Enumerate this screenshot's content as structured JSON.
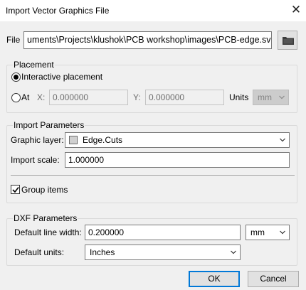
{
  "window": {
    "title": "Import Vector Graphics File",
    "close_glyph": "✕"
  },
  "file": {
    "label": "File",
    "path": "uments\\Projects\\klushok\\PCB workshop\\images\\PCB-edge.svg",
    "browse_icon": "folder-icon"
  },
  "placement": {
    "legend": "Placement",
    "interactive_label": "Interactive placement",
    "interactive_selected": true,
    "at_label": "At",
    "x_label": "X:",
    "x_value": "0.000000",
    "y_label": "Y:",
    "y_value": "0.000000",
    "units_label": "Units",
    "units_value": "mm"
  },
  "import_params": {
    "legend": "Import Parameters",
    "layer_label": "Graphic layer:",
    "layer_value": "Edge.Cuts",
    "layer_swatch_color": "#d0d0d0",
    "scale_label": "Import scale:",
    "scale_value": "1.000000",
    "group_label": "Group items",
    "group_checked": true
  },
  "dxf_params": {
    "legend": "DXF Parameters",
    "line_width_label": "Default line width:",
    "line_width_value": "0.200000",
    "line_width_unit": "mm",
    "units_label": "Default units:",
    "units_value": "Inches"
  },
  "buttons": {
    "ok": "OK",
    "cancel": "Cancel"
  },
  "colors": {
    "accent": "#0078d7",
    "button_face": "#e1e1e1",
    "dialog_bg": "#f0f0f0"
  }
}
